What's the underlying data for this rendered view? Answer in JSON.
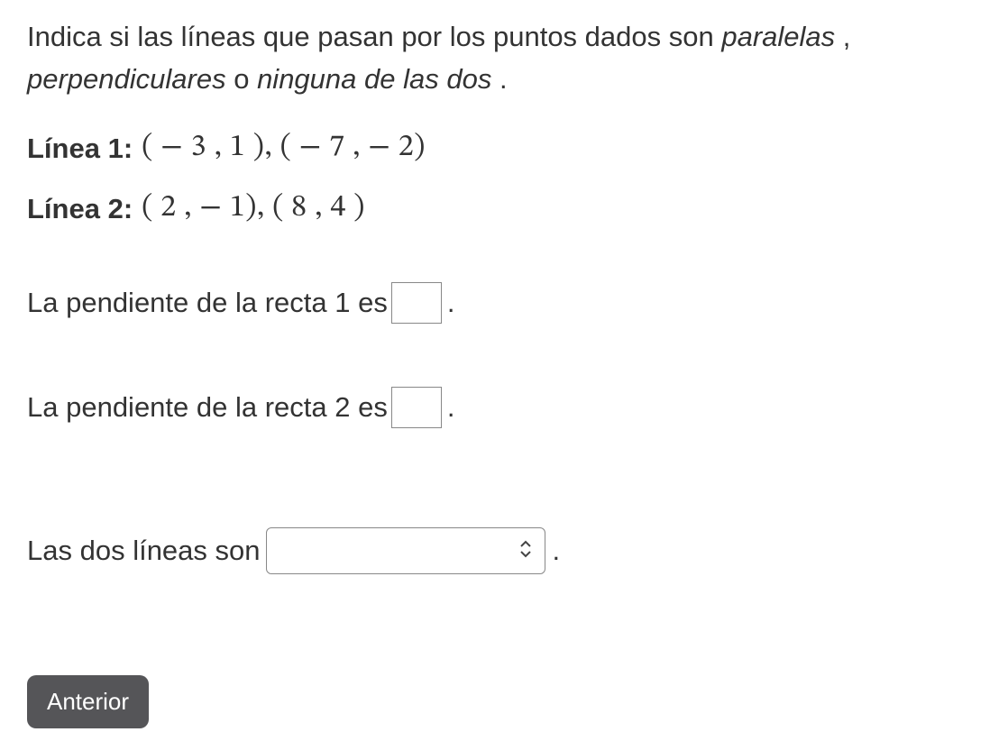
{
  "instruction": {
    "part1": "Indica si las líneas que pasan por los puntos dados son ",
    "italic1": "paralelas ",
    "comma": ", ",
    "italic2": "perpendiculares",
    "mid": " o ",
    "italic3": "ninguna de las dos ",
    "end": "."
  },
  "lines": {
    "line1_label": "Línea 1:",
    "line1_points": "( − 3 , 1  ), ( − 7 , − 2)",
    "line2_label": "Línea 2:",
    "line2_points": "( 2 , − 1), ( 8 , 4  )"
  },
  "answers": {
    "slope1_prefix": "La pendiente de la recta 1 es",
    "slope1_value": "",
    "slope2_prefix": "La pendiente de la recta 2 es",
    "slope2_value": "",
    "final_prefix": "Las dos líneas son",
    "select_value": "",
    "period": "."
  },
  "buttons": {
    "anterior": "Anterior"
  },
  "icons": {
    "updown": "⇳"
  }
}
